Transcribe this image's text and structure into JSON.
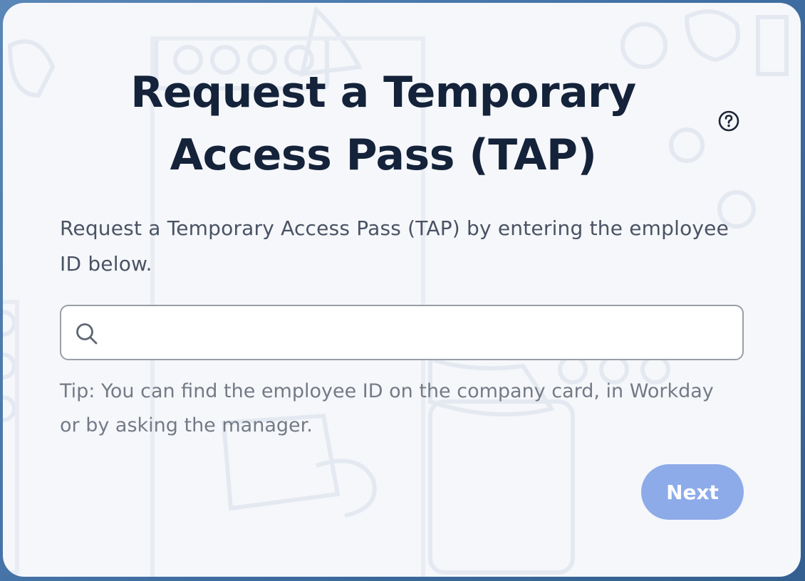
{
  "dialog": {
    "title": "Request a Temporary Access Pass (TAP)",
    "help_icon": "question-circle-icon",
    "intro": "Request a Temporary Access Pass (TAP) by entering the employee ID below.",
    "search": {
      "value": "",
      "placeholder": "",
      "icon": "search-icon"
    },
    "tip": "Tip: You can find the employee ID on the company card, in Workday or by asking the manager.",
    "next_label": "Next"
  },
  "colors": {
    "title": "#14223a",
    "body_text": "#4a5364",
    "tip_text": "#747a86",
    "next_button": "#8dabe9",
    "card_background": "#f5f7fa",
    "frame_background": "#3f6fa3"
  }
}
